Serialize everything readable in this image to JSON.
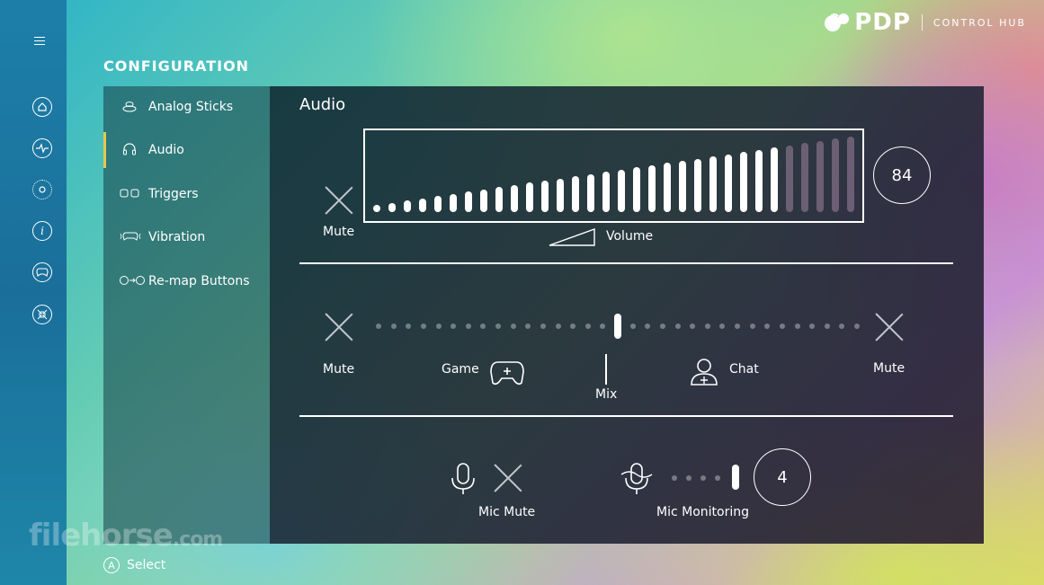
{
  "app": {
    "brand": "PDP",
    "subtitle": "CONTROL HUB"
  },
  "page_title": "CONFIGURATION",
  "side_menu": [
    {
      "label": "Analog Sticks",
      "icon": "analog-stick-icon"
    },
    {
      "label": "Audio",
      "icon": "headset-icon",
      "active": true
    },
    {
      "label": "Triggers",
      "icon": "triggers-icon"
    },
    {
      "label": "Vibration",
      "icon": "vibration-icon"
    },
    {
      "label": "Re-map Buttons",
      "icon": "remap-icon"
    }
  ],
  "audio": {
    "title": "Audio",
    "mute_label": "Mute",
    "volume_label": "Volume",
    "volume_value": "84",
    "volume_level": 0.84,
    "mix": {
      "mute_left": "Mute",
      "game_label": "Game",
      "mix_label": "Mix",
      "chat_label": "Chat",
      "mute_right": "Mute",
      "position": 0.5
    },
    "mic": {
      "mic_mute_label": "Mic Mute",
      "monitoring_label": "Mic Monitoring",
      "monitoring_value": "4"
    }
  },
  "footer": {
    "button": "A",
    "label": "Select"
  },
  "watermark": {
    "text": "filehorse",
    "suffix": ".com"
  },
  "colors": {
    "active_accent": "#e6c84a"
  }
}
